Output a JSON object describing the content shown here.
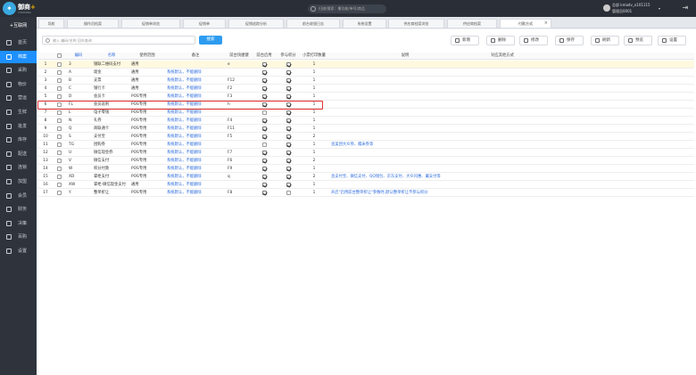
{
  "app": {
    "name": "御商",
    "plus": "+",
    "subtitle": "YUSHANG"
  },
  "topbar": {
    "search_placeholder": "扫描/搜索：播功能/单号/商品",
    "user_line1": "总部 kmadv_o101115",
    "user_line2": "管理员0001"
  },
  "sidebar": {
    "home": "+互联网",
    "items": [
      {
        "label": "首页",
        "icon": "home-icon"
      },
      {
        "label": "档案",
        "icon": "folder-icon",
        "active": true
      },
      {
        "label": "采购",
        "icon": "cart-icon"
      },
      {
        "label": "物价",
        "icon": "tag-icon"
      },
      {
        "label": "营运",
        "icon": "chart-icon"
      },
      {
        "label": "生鲜",
        "icon": "leaf-icon"
      },
      {
        "label": "批发",
        "icon": "truck-icon"
      },
      {
        "label": "库存",
        "icon": "warehouse-icon"
      },
      {
        "label": "配送",
        "icon": "delivery-icon"
      },
      {
        "label": "连锁",
        "icon": "chain-icon"
      },
      {
        "label": "加盟",
        "icon": "handshake-icon"
      },
      {
        "label": "会员",
        "icon": "member-icon"
      },
      {
        "label": "财务",
        "icon": "finance-icon"
      },
      {
        "label": "决策",
        "icon": "decision-icon"
      },
      {
        "label": "百购",
        "icon": "shop-icon"
      },
      {
        "label": "设置",
        "icon": "gear-icon"
      }
    ]
  },
  "tabs": [
    {
      "label": "导航"
    },
    {
      "label": "操作员档案"
    },
    {
      "label": "促销单浏览"
    },
    {
      "label": "促销单"
    },
    {
      "label": "促销追踪分析"
    },
    {
      "label": "前台收银日志"
    },
    {
      "label": "系统设置"
    },
    {
      "label": "供应商档案浏览"
    },
    {
      "label": "供应商档案"
    },
    {
      "label": "付款方式",
      "active": true,
      "close": "×"
    }
  ],
  "toolbar": {
    "search_placeholder": "输入 编码/名称 回车查询",
    "search_button": "搜索",
    "buttons": [
      {
        "label": "新增",
        "icon": "plus-icon"
      },
      {
        "label": "删除",
        "icon": "trash-icon"
      },
      {
        "label": "修改",
        "icon": "edit-icon"
      },
      {
        "label": "保存",
        "icon": "save-icon"
      },
      {
        "label": "刷新",
        "icon": "refresh-icon"
      },
      {
        "label": "预览",
        "icon": "preview-icon"
      },
      {
        "label": "设置",
        "icon": "settings-icon"
      }
    ]
  },
  "table": {
    "headers": {
      "code": "编码",
      "name": "名称",
      "scope": "使用范围",
      "remark": "备注",
      "shortcut": "前台快捷键",
      "front_enabled": "前台启用",
      "points": "参与积分",
      "tickets": "小票打印数量",
      "description": "说明",
      "other": "对应其他方式"
    },
    "rows": [
      {
        "no": "1",
        "code": "3",
        "name": "银联二维码支付",
        "scope": "通用",
        "remark": "",
        "shortcut": "e",
        "front": true,
        "points": true,
        "tickets": "1",
        "desc": "",
        "selected": true
      },
      {
        "no": "2",
        "code": "A",
        "name": "现金",
        "scope": "通用",
        "remark": "系统默认，不能删除",
        "shortcut": "",
        "front": true,
        "points": true,
        "tickets": "1",
        "desc": ""
      },
      {
        "no": "3",
        "code": "B",
        "name": "支票",
        "scope": "通用",
        "remark": "系统默认，不能删除",
        "shortcut": "F12",
        "front": true,
        "points": true,
        "tickets": "1",
        "desc": ""
      },
      {
        "no": "4",
        "code": "C",
        "name": "银行卡",
        "scope": "通用",
        "remark": "系统默认，不能删除",
        "shortcut": "F2",
        "front": true,
        "points": true,
        "tickets": "1",
        "desc": ""
      },
      {
        "no": "5",
        "code": "D",
        "name": "会员卡",
        "scope": "POS专用",
        "remark": "系统默认，不能删除",
        "shortcut": "F3",
        "front": true,
        "points": true,
        "tickets": "1",
        "desc": ""
      },
      {
        "no": "6",
        "code": "FL",
        "name": "会员返利",
        "scope": "POS专用",
        "remark": "系统默认，不能删除",
        "shortcut": "h",
        "front": true,
        "points": true,
        "tickets": "1",
        "desc": ""
      },
      {
        "no": "7",
        "code": "L",
        "name": "电子零钱",
        "scope": "POS专用",
        "remark": "系统默认，不能删除",
        "shortcut": "",
        "front": false,
        "points": true,
        "tickets": "1",
        "desc": ""
      },
      {
        "no": "8",
        "code": "N",
        "name": "礼券",
        "scope": "POS专用",
        "remark": "系统默认，不能删除",
        "shortcut": "F4",
        "front": true,
        "points": true,
        "tickets": "1",
        "desc": ""
      },
      {
        "no": "9",
        "code": "Q",
        "name": "商联通卡",
        "scope": "POS专用",
        "remark": "系统默认，不能删除",
        "shortcut": "F11",
        "front": true,
        "points": true,
        "tickets": "1",
        "desc": ""
      },
      {
        "no": "10",
        "code": "S",
        "name": "支付宝",
        "scope": "POS专用",
        "remark": "系统默认，不能删除",
        "shortcut": "F5",
        "front": true,
        "points": true,
        "tickets": "2",
        "desc": ""
      },
      {
        "no": "11",
        "code": "TG",
        "name": "团购券",
        "scope": "POS专用",
        "remark": "系统默认，不能删除",
        "shortcut": "",
        "front": false,
        "points": true,
        "tickets": "1",
        "desc": "含美团大众券、糯米券等"
      },
      {
        "no": "12",
        "code": "U",
        "name": "微信现金券",
        "scope": "POS专用",
        "remark": "系统默认，不能删除",
        "shortcut": "F7",
        "front": true,
        "points": true,
        "tickets": "1",
        "desc": ""
      },
      {
        "no": "13",
        "code": "V",
        "name": "微信支付",
        "scope": "POS专用",
        "remark": "系统默认，不能删除",
        "shortcut": "F6",
        "front": true,
        "points": true,
        "tickets": "2",
        "desc": ""
      },
      {
        "no": "14",
        "code": "W",
        "name": "积分付款",
        "scope": "POS专用",
        "remark": "系统默认，不能删除",
        "shortcut": "F9",
        "front": true,
        "points": true,
        "tickets": "1",
        "desc": ""
      },
      {
        "no": "15",
        "code": "XD",
        "name": "掌柜支付",
        "scope": "POS专用",
        "remark": "系统默认，不能删除",
        "shortcut": "q",
        "front": true,
        "points": true,
        "tickets": "2",
        "desc": "含支付宝、微信支付、QQ钱包、京东支付、大众闪惠、翼支付等"
      },
      {
        "no": "16",
        "code": "XW",
        "name": "掌柜-微信现金支付",
        "scope": "通用",
        "remark": "系统默认，不能删除",
        "shortcut": "",
        "front": true,
        "points": true,
        "tickets": "1",
        "desc": ""
      },
      {
        "no": "17",
        "code": "Y",
        "name": "整单折让",
        "scope": "POS专用",
        "remark": "系统默认，不能删除",
        "shortcut": "F8",
        "front": true,
        "points": false,
        "tickets": "1",
        "desc": "开启\"启用前台整单折让\"参数时,默认整单折让不参与积分"
      }
    ]
  },
  "colors": {
    "accent": "#1e90ff",
    "topbar": "#2a2f37",
    "sidebar": "#2f343c",
    "highlight": "#e03030",
    "link": "#2d6cdf"
  }
}
